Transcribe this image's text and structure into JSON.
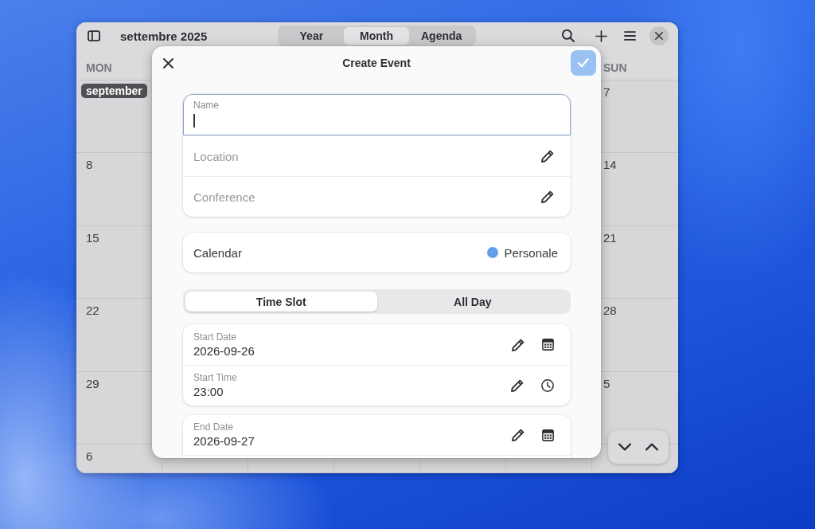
{
  "window": {
    "title": "settembre 2025",
    "views": [
      {
        "label": "Year",
        "selected": false
      },
      {
        "label": "Month",
        "selected": true
      },
      {
        "label": "Agenda",
        "selected": false
      }
    ]
  },
  "month_grid": {
    "first_column": {
      "heading": "MON",
      "cells": [
        {
          "kind": "month",
          "text": "september"
        },
        {
          "kind": "day",
          "text": "8"
        },
        {
          "kind": "day",
          "text": "15"
        },
        {
          "kind": "day",
          "text": "22"
        },
        {
          "kind": "day",
          "text": "29"
        },
        {
          "kind": "day",
          "text": "6"
        }
      ]
    },
    "last_column": {
      "heading": "SUN",
      "cells": [
        {
          "kind": "day",
          "text": "7"
        },
        {
          "kind": "day",
          "text": "14"
        },
        {
          "kind": "day",
          "text": "21"
        },
        {
          "kind": "day",
          "text": "28"
        },
        {
          "kind": "day",
          "text": "5"
        }
      ]
    }
  },
  "dialog": {
    "title": "Create Event",
    "confirm": {
      "disabled": true
    },
    "entries": [
      {
        "label": "Name",
        "focused": true
      },
      {
        "label": "Location",
        "focused": false
      },
      {
        "label": "Conference",
        "focused": false
      }
    ],
    "calendar": {
      "label": "Calendar",
      "value": "Personale",
      "color": "#62a0ea"
    },
    "time_mode": [
      {
        "label": "Time Slot",
        "selected": true
      },
      {
        "label": "All Day",
        "selected": false
      }
    ],
    "groups": [
      {
        "rows": [
          {
            "kind": "date",
            "label": "Start Date",
            "value": "2026-09-26"
          },
          {
            "kind": "time",
            "label": "Start Time",
            "value": "23:00"
          }
        ]
      },
      {
        "rows": [
          {
            "kind": "date",
            "label": "End Date",
            "value": "2026-09-27"
          }
        ]
      }
    ]
  }
}
